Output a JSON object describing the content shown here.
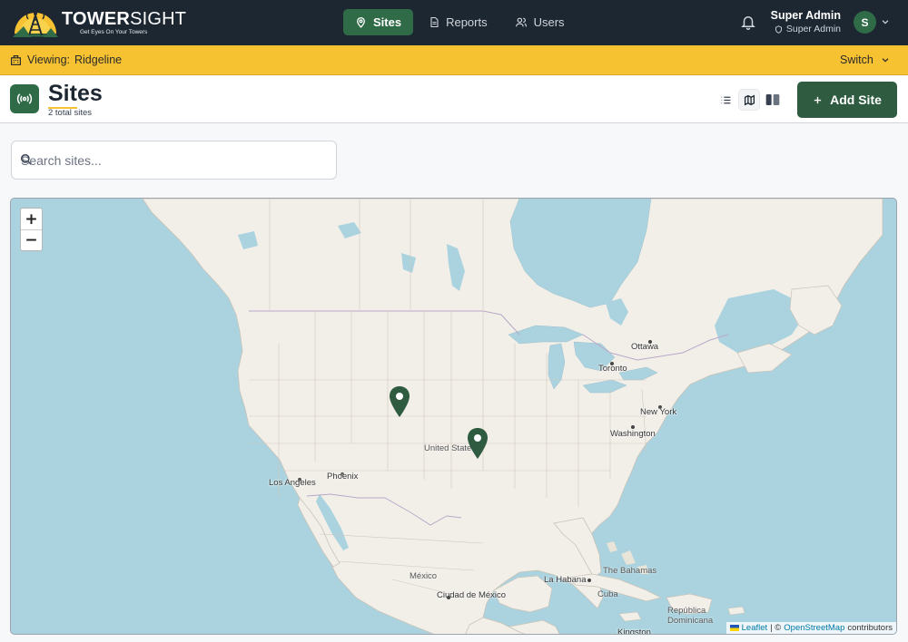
{
  "brand": {
    "name_bold": "TOWER",
    "name_light": "SIGHT",
    "tagline": "Get Eyes On Your Towers"
  },
  "nav": {
    "items": [
      {
        "label": "Sites",
        "icon": "map-pin-icon",
        "active": true
      },
      {
        "label": "Reports",
        "icon": "document-icon",
        "active": false
      },
      {
        "label": "Users",
        "icon": "users-icon",
        "active": false
      }
    ]
  },
  "user": {
    "name": "Super Admin",
    "role": "Super Admin",
    "initial": "S"
  },
  "context": {
    "label": "Viewing:",
    "value": "Ridgeline",
    "switch_label": "Switch"
  },
  "page": {
    "title": "Sites",
    "subtitle": "2 total sites",
    "add_label": "Add Site"
  },
  "view_modes": {
    "options": [
      "list-view-icon",
      "map-view-icon",
      "split-view-icon"
    ],
    "active": "map"
  },
  "search": {
    "placeholder": "Search sites...",
    "value": ""
  },
  "map": {
    "zoom_in": "+",
    "zoom_out": "−",
    "labels": {
      "ottawa": "Ottawa",
      "toronto": "Toronto",
      "new_york": "New York",
      "washington": "Washington",
      "united_states": "United States",
      "phoenix": "Phoenix",
      "los_angeles": "Los Angeles",
      "mexico": "México",
      "mexico_city": "Ciudad de México",
      "la_habana": "La Habana",
      "bahamas": "The Bahamas",
      "cuba": "Cuba",
      "dominicana": "República Dominicana",
      "kingston": "Kingston"
    },
    "attribution": {
      "leaflet": "Leaflet",
      "sep": "| ©",
      "osm": "OpenStreetMap",
      "contributors": "contributors"
    }
  },
  "colors": {
    "nav_bg": "#1d2731",
    "accent_green": "#2f6b47",
    "context_yellow": "#f6c231",
    "water": "#aad3df",
    "land": "#f2efe9"
  }
}
